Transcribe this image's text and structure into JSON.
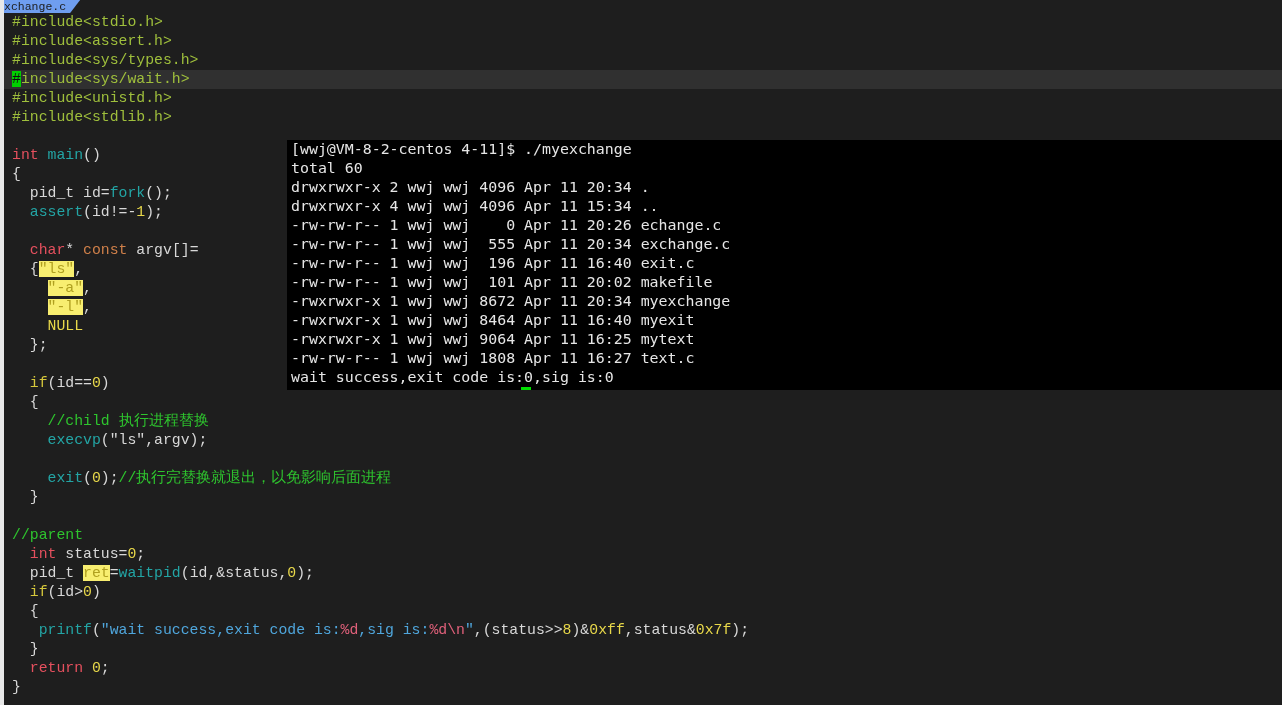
{
  "tab": {
    "title": "xchange.c"
  },
  "editor": {
    "lines": [
      {
        "current": false,
        "tokens": [
          {
            "kind": "preproc",
            "text": "#include<stdio.h>"
          }
        ]
      },
      {
        "current": false,
        "tokens": [
          {
            "kind": "preproc",
            "text": "#include<assert.h>"
          }
        ]
      },
      {
        "current": false,
        "tokens": [
          {
            "kind": "preproc",
            "text": "#include<sys/types.h>"
          }
        ]
      },
      {
        "current": true,
        "tokens": [
          {
            "kind": "cursor",
            "text": "#"
          },
          {
            "kind": "preproc",
            "text": "include<sys/wait.h>"
          }
        ]
      },
      {
        "current": false,
        "tokens": [
          {
            "kind": "preproc",
            "text": "#include<unistd.h>"
          }
        ]
      },
      {
        "current": false,
        "tokens": [
          {
            "kind": "preproc",
            "text": "#include<stdlib.h>"
          }
        ]
      },
      {
        "current": false
      },
      {
        "current": false,
        "tokens": [
          {
            "kind": "keyword",
            "text": "int "
          },
          {
            "kind": "func",
            "text": "main"
          },
          {
            "kind": "plain",
            "text": "()"
          }
        ]
      },
      {
        "current": false,
        "tokens": [
          {
            "kind": "plain",
            "text": "{"
          }
        ]
      },
      {
        "current": false,
        "tokens": [
          {
            "kind": "plain",
            "text": "  pid_t id="
          },
          {
            "kind": "func",
            "text": "fork"
          },
          {
            "kind": "plain",
            "text": "();"
          }
        ]
      },
      {
        "current": false,
        "tokens": [
          {
            "kind": "func",
            "text": "  assert"
          },
          {
            "kind": "plain",
            "text": "(id!=-"
          },
          {
            "kind": "number",
            "text": "1"
          },
          {
            "kind": "plain",
            "text": ");"
          }
        ]
      },
      {
        "current": false
      },
      {
        "current": false,
        "tokens": [
          {
            "kind": "keyword",
            "text": "  char"
          },
          {
            "kind": "plain",
            "text": "* "
          },
          {
            "kind": "storage",
            "text": "const"
          },
          {
            "kind": "plain",
            "text": " argv[]="
          }
        ]
      },
      {
        "current": false,
        "tokens": [
          {
            "kind": "plain",
            "text": "  {"
          },
          {
            "kind": "match",
            "text": "\"ls\""
          },
          {
            "kind": "plain",
            "text": ","
          }
        ]
      },
      {
        "current": false,
        "tokens": [
          {
            "kind": "match",
            "text": "    \"-a\""
          },
          {
            "kind": "plain",
            "text": ","
          }
        ]
      },
      {
        "current": false,
        "tokens": [
          {
            "kind": "match",
            "text": "    \"-l\""
          },
          {
            "kind": "plain",
            "text": ","
          }
        ]
      },
      {
        "current": false,
        "tokens": [
          {
            "kind": "number",
            "text": "    NULL"
          }
        ]
      },
      {
        "current": false,
        "tokens": [
          {
            "kind": "plain",
            "text": "  };"
          }
        ]
      },
      {
        "current": false
      },
      {
        "current": false,
        "tokens": [
          {
            "kind": "cond",
            "text": "  if"
          },
          {
            "kind": "plain",
            "text": "(id=="
          },
          {
            "kind": "number",
            "text": "0"
          },
          {
            "kind": "plain",
            "text": ")"
          }
        ]
      },
      {
        "current": false,
        "tokens": [
          {
            "kind": "plain",
            "text": "  {"
          }
        ]
      },
      {
        "current": false,
        "tokens": [
          {
            "kind": "comment",
            "text": "    //child 执行进程替换"
          }
        ]
      },
      {
        "current": false,
        "tokens": [
          {
            "kind": "func",
            "text": "    execvp"
          },
          {
            "kind": "plain",
            "text": "(\"ls\",argv);"
          }
        ]
      },
      {
        "current": false
      },
      {
        "current": false,
        "tokens": [
          {
            "kind": "func",
            "text": "    exit"
          },
          {
            "kind": "plain",
            "text": "("
          },
          {
            "kind": "number",
            "text": "0"
          },
          {
            "kind": "plain",
            "text": ");"
          },
          {
            "kind": "comment",
            "text": "//执行完替换就退出，以免影响后面进程"
          }
        ]
      },
      {
        "current": false,
        "tokens": [
          {
            "kind": "plain",
            "text": "  }"
          }
        ]
      },
      {
        "current": false
      },
      {
        "current": false,
        "tokens": [
          {
            "kind": "comment",
            "text": "//parent"
          }
        ]
      },
      {
        "current": false,
        "tokens": [
          {
            "kind": "keyword",
            "text": "  int"
          },
          {
            "kind": "plain",
            "text": " status="
          },
          {
            "kind": "number",
            "text": "0"
          },
          {
            "kind": "plain",
            "text": ";"
          }
        ]
      },
      {
        "current": false,
        "tokens": [
          {
            "kind": "plain",
            "text": "  pid_t "
          },
          {
            "kind": "match",
            "text": "ret"
          },
          {
            "kind": "plain",
            "text": "="
          },
          {
            "kind": "func",
            "text": "waitpid"
          },
          {
            "kind": "plain",
            "text": "(id,&status,"
          },
          {
            "kind": "number",
            "text": "0"
          },
          {
            "kind": "plain",
            "text": ");"
          }
        ]
      },
      {
        "current": false,
        "tokens": [
          {
            "kind": "cond",
            "text": "  if"
          },
          {
            "kind": "plain",
            "text": "(id>"
          },
          {
            "kind": "number",
            "text": "0"
          },
          {
            "kind": "plain",
            "text": ")"
          }
        ]
      },
      {
        "current": false,
        "tokens": [
          {
            "kind": "plain",
            "text": "  {"
          }
        ]
      },
      {
        "current": false,
        "tokens": [
          {
            "kind": "func",
            "text": "   printf"
          },
          {
            "kind": "plain",
            "text": "("
          },
          {
            "kind": "string",
            "text": "\"wait success,exit code is:"
          },
          {
            "kind": "format",
            "text": "%d"
          },
          {
            "kind": "string",
            "text": ",sig is:"
          },
          {
            "kind": "format",
            "text": "%d\\n"
          },
          {
            "kind": "string",
            "text": "\""
          },
          {
            "kind": "plain",
            "text": ",(status>>"
          },
          {
            "kind": "number",
            "text": "8"
          },
          {
            "kind": "plain",
            "text": ")&"
          },
          {
            "kind": "number",
            "text": "0xff"
          },
          {
            "kind": "plain",
            "text": ",status&"
          },
          {
            "kind": "number",
            "text": "0x7f"
          },
          {
            "kind": "plain",
            "text": ");"
          }
        ]
      },
      {
        "current": false,
        "tokens": [
          {
            "kind": "plain",
            "text": "  }"
          }
        ]
      },
      {
        "current": false,
        "tokens": [
          {
            "kind": "keyword",
            "text": "  return "
          },
          {
            "kind": "number",
            "text": "0"
          },
          {
            "kind": "plain",
            "text": ";"
          }
        ]
      },
      {
        "current": false,
        "tokens": [
          {
            "kind": "plain",
            "text": "}"
          }
        ]
      }
    ]
  },
  "terminal": {
    "lines": [
      "[wwj@VM-8-2-centos 4-11]$ ./myexchange",
      "total 60",
      "drwxrwxr-x 2 wwj wwj 4096 Apr 11 20:34 .",
      "drwxrwxr-x 4 wwj wwj 4096 Apr 11 15:34 ..",
      "-rw-rw-r-- 1 wwj wwj    0 Apr 11 20:26 echange.c",
      "-rw-rw-r-- 1 wwj wwj  555 Apr 11 20:34 exchange.c",
      "-rw-rw-r-- 1 wwj wwj  196 Apr 11 16:40 exit.c",
      "-rw-rw-r-- 1 wwj wwj  101 Apr 11 20:02 makefile",
      "-rwxrwxr-x 1 wwj wwj 8672 Apr 11 20:34 myexchange",
      "-rwxrwxr-x 1 wwj wwj 8464 Apr 11 16:40 myexit",
      "-rwxrwxr-x 1 wwj wwj 9064 Apr 11 16:25 mytext",
      "-rw-rw-r-- 1 wwj wwj 1808 Apr 11 16:27 text.c",
      "wait success,exit code is:0,sig is:0"
    ]
  }
}
